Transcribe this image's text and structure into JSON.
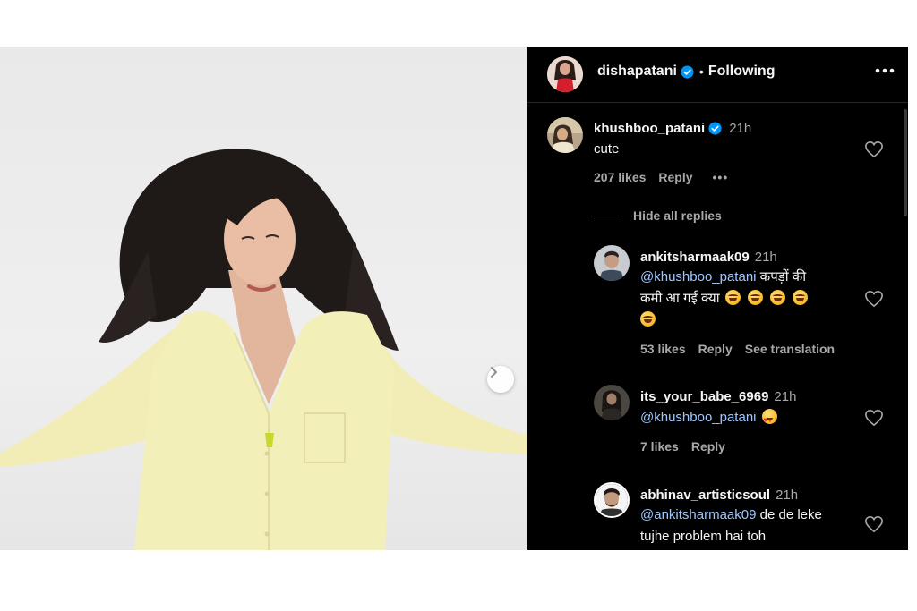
{
  "post": {
    "author": "dishapatani",
    "author_verified": true,
    "separator": "•",
    "follow_status": "Following",
    "more_icon": "more-horizontal-icon",
    "carousel_next_icon": "chevron-right-icon"
  },
  "comments": {
    "main": {
      "username": "khushboo_patani",
      "verified": true,
      "time": "21h",
      "text": "cute",
      "likes": "207 likes",
      "reply_label": "Reply",
      "more_label": "•••"
    },
    "hide_replies_label": "Hide all replies",
    "replies": [
      {
        "username": "ankitsharmaak09",
        "time": "21h",
        "mention": "@khushboo_patani",
        "text_line1": " कपड़ों की",
        "text_line2": "कमी आ गई क्या",
        "emoji_count": 5,
        "emoji": "laughing-emoji",
        "likes": "53 likes",
        "reply_label": "Reply",
        "translate_label": "See translation"
      },
      {
        "username": "its_your_babe_6969",
        "time": "21h",
        "mention": "@khushboo_patani",
        "emoji": "heart-eyes-emoji",
        "likes": "7 likes",
        "reply_label": "Reply"
      },
      {
        "username": "abhinav_artisticsoul",
        "time": "21h",
        "mention": "@ankitsharmaak09",
        "text_line1": " de de leke",
        "text_line2": "tujhe problem hai toh"
      }
    ]
  },
  "colors": {
    "panel_bg": "#000000",
    "verified_blue": "#0095f6",
    "mention_blue": "#9ec7ff",
    "muted": "#a8a8a8",
    "shirt": "#f3efb9"
  }
}
